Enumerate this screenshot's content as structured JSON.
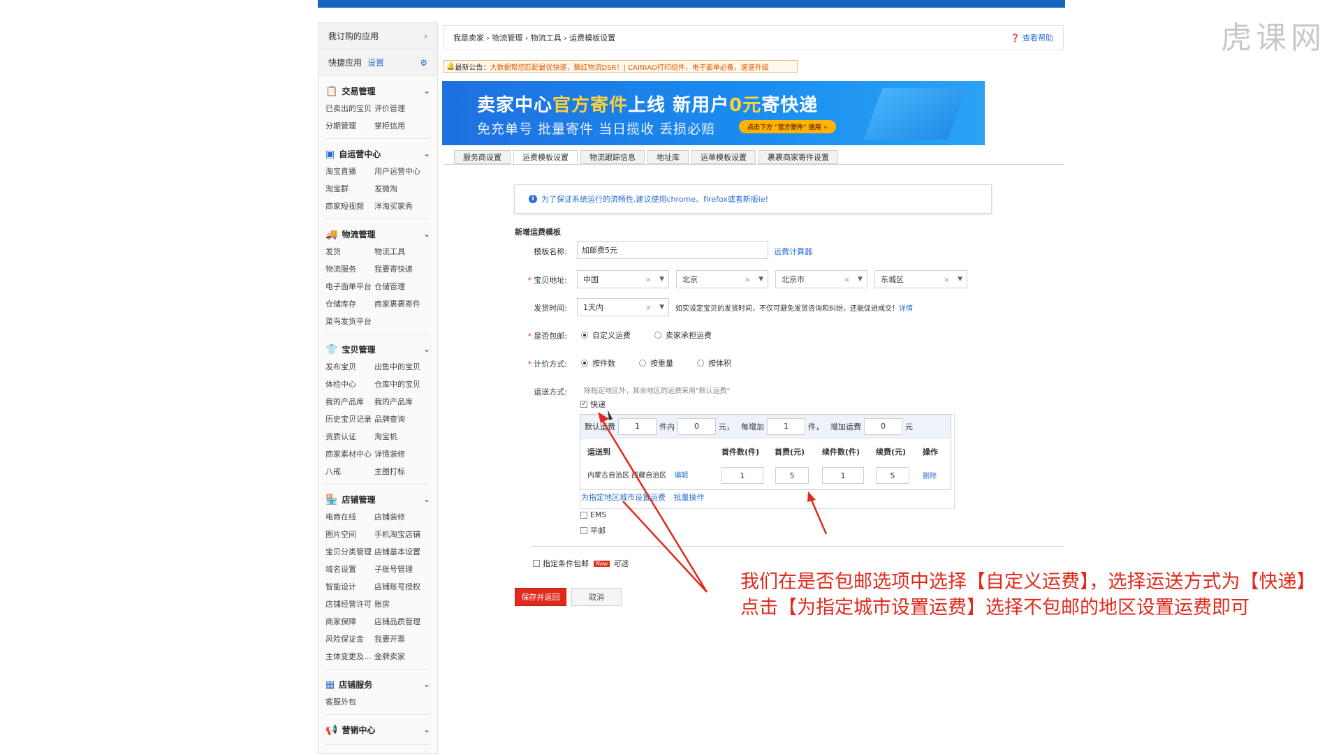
{
  "watermark": "虎课网",
  "sidebar": {
    "apps_label": "我订购的应用",
    "quick_label": "快捷应用",
    "quick_set": "设置",
    "groups": [
      {
        "title": "交易管理",
        "items": [
          "已卖出的宝贝",
          "评价管理",
          "分期管理",
          "掌柜信用"
        ]
      },
      {
        "title": "自运营中心",
        "items": [
          "淘宝直播",
          "用户运营中心",
          "淘宝群",
          "发微淘",
          "商家短视频",
          "洋淘买家秀"
        ]
      },
      {
        "title": "物流管理",
        "items": [
          "发货",
          "物流工具",
          "物流服务",
          "我要寄快递",
          "电子面单平台",
          "仓储管理",
          "仓储库存",
          "商家裹裹寄件",
          "菜鸟发货平台"
        ]
      },
      {
        "title": "宝贝管理",
        "items": [
          "发布宝贝",
          "出售中的宝贝",
          "体检中心",
          "仓库中的宝贝",
          "我的产品库",
          "我的产品库",
          "历史宝贝记录",
          "品牌查询",
          "资质认证",
          "淘宝机",
          "商家素材中心",
          "详情装修",
          "八戒",
          "主图打标"
        ]
      },
      {
        "title": "店铺管理",
        "items": [
          "电商在线",
          "店铺装修",
          "图片空间",
          "手机淘宝店铺",
          "宝贝分类管理",
          "店铺基本设置",
          "域名设置",
          "子账号管理",
          "智能设计",
          "店铺账号授权",
          "店铺经营许可",
          "账房",
          "商家保障",
          "店铺品质管理",
          "风险保证金",
          "我要开票",
          "主体变更及...",
          "金牌卖家"
        ]
      },
      {
        "title": "店铺服务",
        "items": [
          "客服外包"
        ]
      },
      {
        "title": "营销中心",
        "items": []
      }
    ]
  },
  "breadcrumb": {
    "text": "我是卖家 › 物流管理 › 物流工具 › 运费模板设置",
    "help": "查看帮助"
  },
  "notice": {
    "prefix": "最新公告：",
    "highlight": "大数据帮您匹配最优快递，飘红物流DSR！| CAINIAO打印组件，电子面单必备，速速升级",
    "link": ""
  },
  "banner": {
    "line1_a": "卖家中心",
    "line1_b": "官方寄件",
    "line1_c": "上线  新用户",
    "line1_d": "0元",
    "line1_e": "寄快递",
    "line2": "免充单号 批量寄件 当日揽收 丢损必赔",
    "cta": "点击下方 \"官方寄件\" 使用 »"
  },
  "tabs": [
    "服务商设置",
    "运费模板设置",
    "物流跟踪信息",
    "地址库",
    "运单模板设置",
    "裹裹商家寄件设置"
  ],
  "tip": "为了保证系统运行的流畅性,建议使用chrome、firefox或者新版ie!",
  "form": {
    "section_title": "新增运费模板",
    "name_label": "模板名称:",
    "name_value": "加邮费5元",
    "calc_link": "运费计算器",
    "address_label": "宝贝地址:",
    "address": [
      "中国",
      "北京",
      "北京市",
      "东城区"
    ],
    "ship_time_label": "发货时间:",
    "ship_time_value": "1天内",
    "ship_time_note": "如实设定宝贝的发货时间，不仅可避免发货咨询和纠纷，还能促进成交！",
    "ship_time_detail": "详情",
    "free_label": "是否包邮:",
    "free_opt1": "自定义运费",
    "free_opt2": "卖家承担运费",
    "pricing_label": "计价方式:",
    "pricing_opt1": "按件数",
    "pricing_opt2": "按重量",
    "pricing_opt3": "按体积",
    "method_label": "运送方式:",
    "method_note": "除指定地区外，其余地区的运费采用\"默认运费\"",
    "express": "快递",
    "default_fee_label": "默认运费",
    "default_qty": "1",
    "unit_within": "件内",
    "default_fee": "0",
    "yuan_each": "元，",
    "each_add_label": "每增加",
    "add_qty": "1",
    "unit_piece": "件，",
    "add_fee_label": "增加运费",
    "add_fee": "0",
    "yuan": "元",
    "table_headers": [
      "运送到",
      "首件数(件)",
      "首费(元)",
      "续件数(件)",
      "续费(元)",
      "操作"
    ],
    "row_regions": "内蒙古自治区  西藏自治区",
    "row_edit": "编辑",
    "row_values": [
      "1",
      "5",
      "1",
      "5"
    ],
    "row_delete": "删除",
    "set_city_link": "为指定地区城市设置运费",
    "batch_link": "批量操作",
    "ems": "EMS",
    "post": "平邮",
    "cond_free": "指定条件包邮",
    "new_tag": "New",
    "optional": "可选",
    "save_btn": "保存并返回",
    "cancel_btn": "取消"
  },
  "caption": "我们在是否包邮选项中选择【自定义运费】，选择运送方式为【快递】点击【为指定城市设置运费】选择不包邮的地区设置运费即可"
}
